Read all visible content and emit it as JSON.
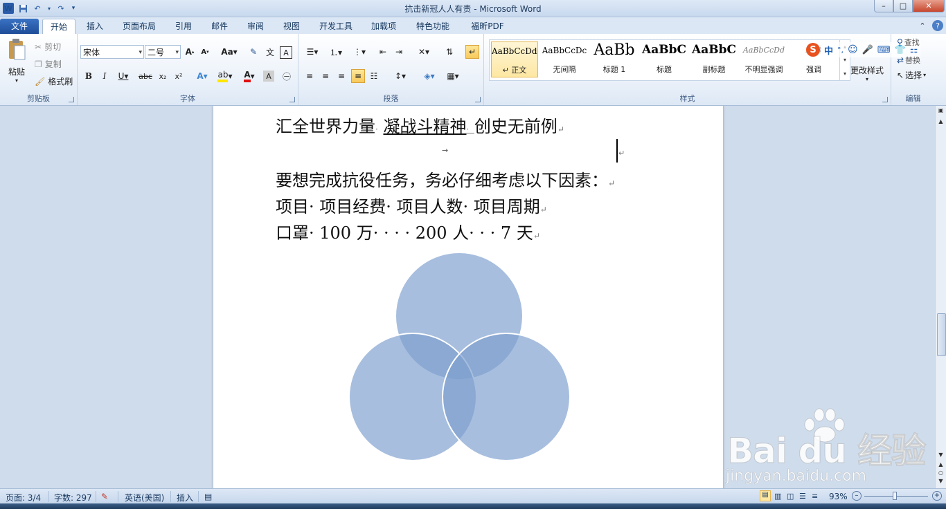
{
  "window": {
    "title": "抗击新冠人人有责 - Microsoft Word",
    "controls": {
      "minimize": "–",
      "maximize": "□",
      "close": "✕"
    }
  },
  "qat": {
    "word_icon": "W",
    "save_icon": "save-icon",
    "undo_icon": "undo-icon",
    "redo_icon": "redo-icon"
  },
  "tabs": {
    "file": "文件",
    "items": [
      "开始",
      "插入",
      "页面布局",
      "引用",
      "邮件",
      "审阅",
      "视图",
      "开发工具",
      "加载项",
      "特色功能",
      "福昕PDF"
    ]
  },
  "clipboard": {
    "paste": "粘贴",
    "cut": "剪切",
    "copy": "复制",
    "format_painter": "格式刷",
    "label": "剪贴板"
  },
  "font": {
    "name": "宋体",
    "size": "二号",
    "label": "字体"
  },
  "paragraph": {
    "label": "段落"
  },
  "styles": {
    "label": "样式",
    "items": [
      {
        "sample": "AaBbCcDdI",
        "name": "↵ 正文"
      },
      {
        "sample": "AaBbCcDc",
        "name": "无间隔"
      },
      {
        "sample": "AaBb",
        "name": "标题 1"
      },
      {
        "sample": "AaBbC",
        "name": "标题"
      },
      {
        "sample": "AaBbC",
        "name": "副标题"
      },
      {
        "sample": "AaBbCcDd",
        "name": "不明显强调"
      },
      {
        "sample": "AaB",
        "name": "强调"
      }
    ],
    "change_styles": "更改样式"
  },
  "editing": {
    "find": "查找",
    "replace": "替换",
    "select": "选择",
    "label": "编辑"
  },
  "ime": {
    "lang": "中",
    "punct": "°,"
  },
  "document": {
    "line1_a": "汇全世界力量",
    "line1_b": "凝战斗精神",
    "line1_c": "创史无前例",
    "line2": "要想完成抗役任务，务必仔细考虑以下因素：",
    "line3": "项目· 项目经费· 项目人数· 项目周期",
    "line4": "口罩· 100 万· · · · 200 人· · · 7 天",
    "para_mark": "↵",
    "tab_mark": "→"
  },
  "venn": {
    "fill": "#7d9fce",
    "opacity": 0.68,
    "stroke": "#ffffff"
  },
  "status": {
    "page": "页面: 3/4",
    "words": "字数: 297",
    "lang": "英语(美国)",
    "mode": "插入",
    "zoom": "93%"
  },
  "watermark": {
    "brand": "Bai du 经验",
    "url": "jingyan.baidu.com"
  },
  "colors": {
    "accent": "#2a5caa",
    "ribbon_bg": "#e9f0f9",
    "doc_bg": "#cfdcec"
  }
}
